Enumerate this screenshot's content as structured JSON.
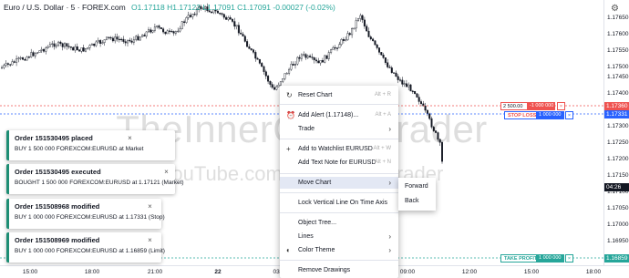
{
  "header": {
    "symbol": "Euro / U.S. Dollar · 5 · FOREX.com",
    "ohlc": "O1.17118 H1.17122 L1.17091 C1.17091 -0.00027 (-0.02%)"
  },
  "watermark": {
    "line1": "TheInnerCircleTrader",
    "line2": "YouTube.com/InnerCircleTrader"
  },
  "price_axis": {
    "ticks": [
      "1.17650",
      "1.17600",
      "1.17550",
      "1.17500",
      "1.17450",
      "1.17400",
      "1.17300",
      "1.17250",
      "1.17200",
      "1.17150",
      "1.17100",
      "1.17050",
      "1.17000",
      "1.16950",
      "1.16900",
      "1.16859"
    ],
    "labels": {
      "sell": "1.17360",
      "stop": "1.17331",
      "time": "04:26",
      "tp": "1.16859"
    },
    "colors": {
      "sell": "#ef5350",
      "stop": "#2962ff",
      "time": "#131722",
      "tp": "#26a69a"
    }
  },
  "time_axis": {
    "ticks": [
      "15:00",
      "18:00",
      "21:00",
      "22",
      "03:",
      "09:00",
      "12:00",
      "15:00",
      "18:00"
    ]
  },
  "notifications": [
    {
      "title": "Order 151530495 placed",
      "body": "BUY 1 500 000 FOREXCOM:EURUSD at Market"
    },
    {
      "title": "Order 151530495 executed",
      "body": "BOUGHT 1 500 000 FOREXCOM:EURUSD at 1.17121   (Market)"
    },
    {
      "title": "Order 151508968 modified",
      "body": "BUY 1 000 000 FOREXCOM:EURUSD at 1.17331   (Stop)"
    },
    {
      "title": "Order 151508969 modified",
      "body": "BUY 1 000 000 FOREXCOM:EURUSD at 1.16859   (Limit)"
    }
  ],
  "menu": {
    "reset": {
      "label": "Reset Chart",
      "shortcut": "Alt + R"
    },
    "alert": {
      "label": "Add Alert (1.17148)...",
      "shortcut": "Alt + A"
    },
    "trade": {
      "label": "Trade"
    },
    "watchlist": {
      "label": "Add to Watchlist EURUSD",
      "shortcut": "Alt + W"
    },
    "note": {
      "label": "Add Text Note for EURUSD",
      "shortcut": "Alt + N"
    },
    "move": {
      "label": "Move Chart"
    },
    "lock": {
      "label": "Lock Vertical Line On Time Axis"
    },
    "tree": {
      "label": "Object Tree..."
    },
    "lines": {
      "label": "Lines"
    },
    "theme": {
      "label": "Color Theme"
    },
    "remove": {
      "label": "Remove Drawings"
    }
  },
  "submenu": {
    "forward": "Forward",
    "back": "Back"
  },
  "orders": {
    "sell_qty": "2 500.00",
    "sell_pnl": "-1 000 000",
    "stop_label": "STOP LOSS",
    "stop_qty": "1 000 000",
    "tp_label": "TAKE PROFIT",
    "tp_qty": "1 000 000"
  },
  "close_glyph": "×",
  "gear_glyph": "⚙",
  "arrow_glyph": "›"
}
